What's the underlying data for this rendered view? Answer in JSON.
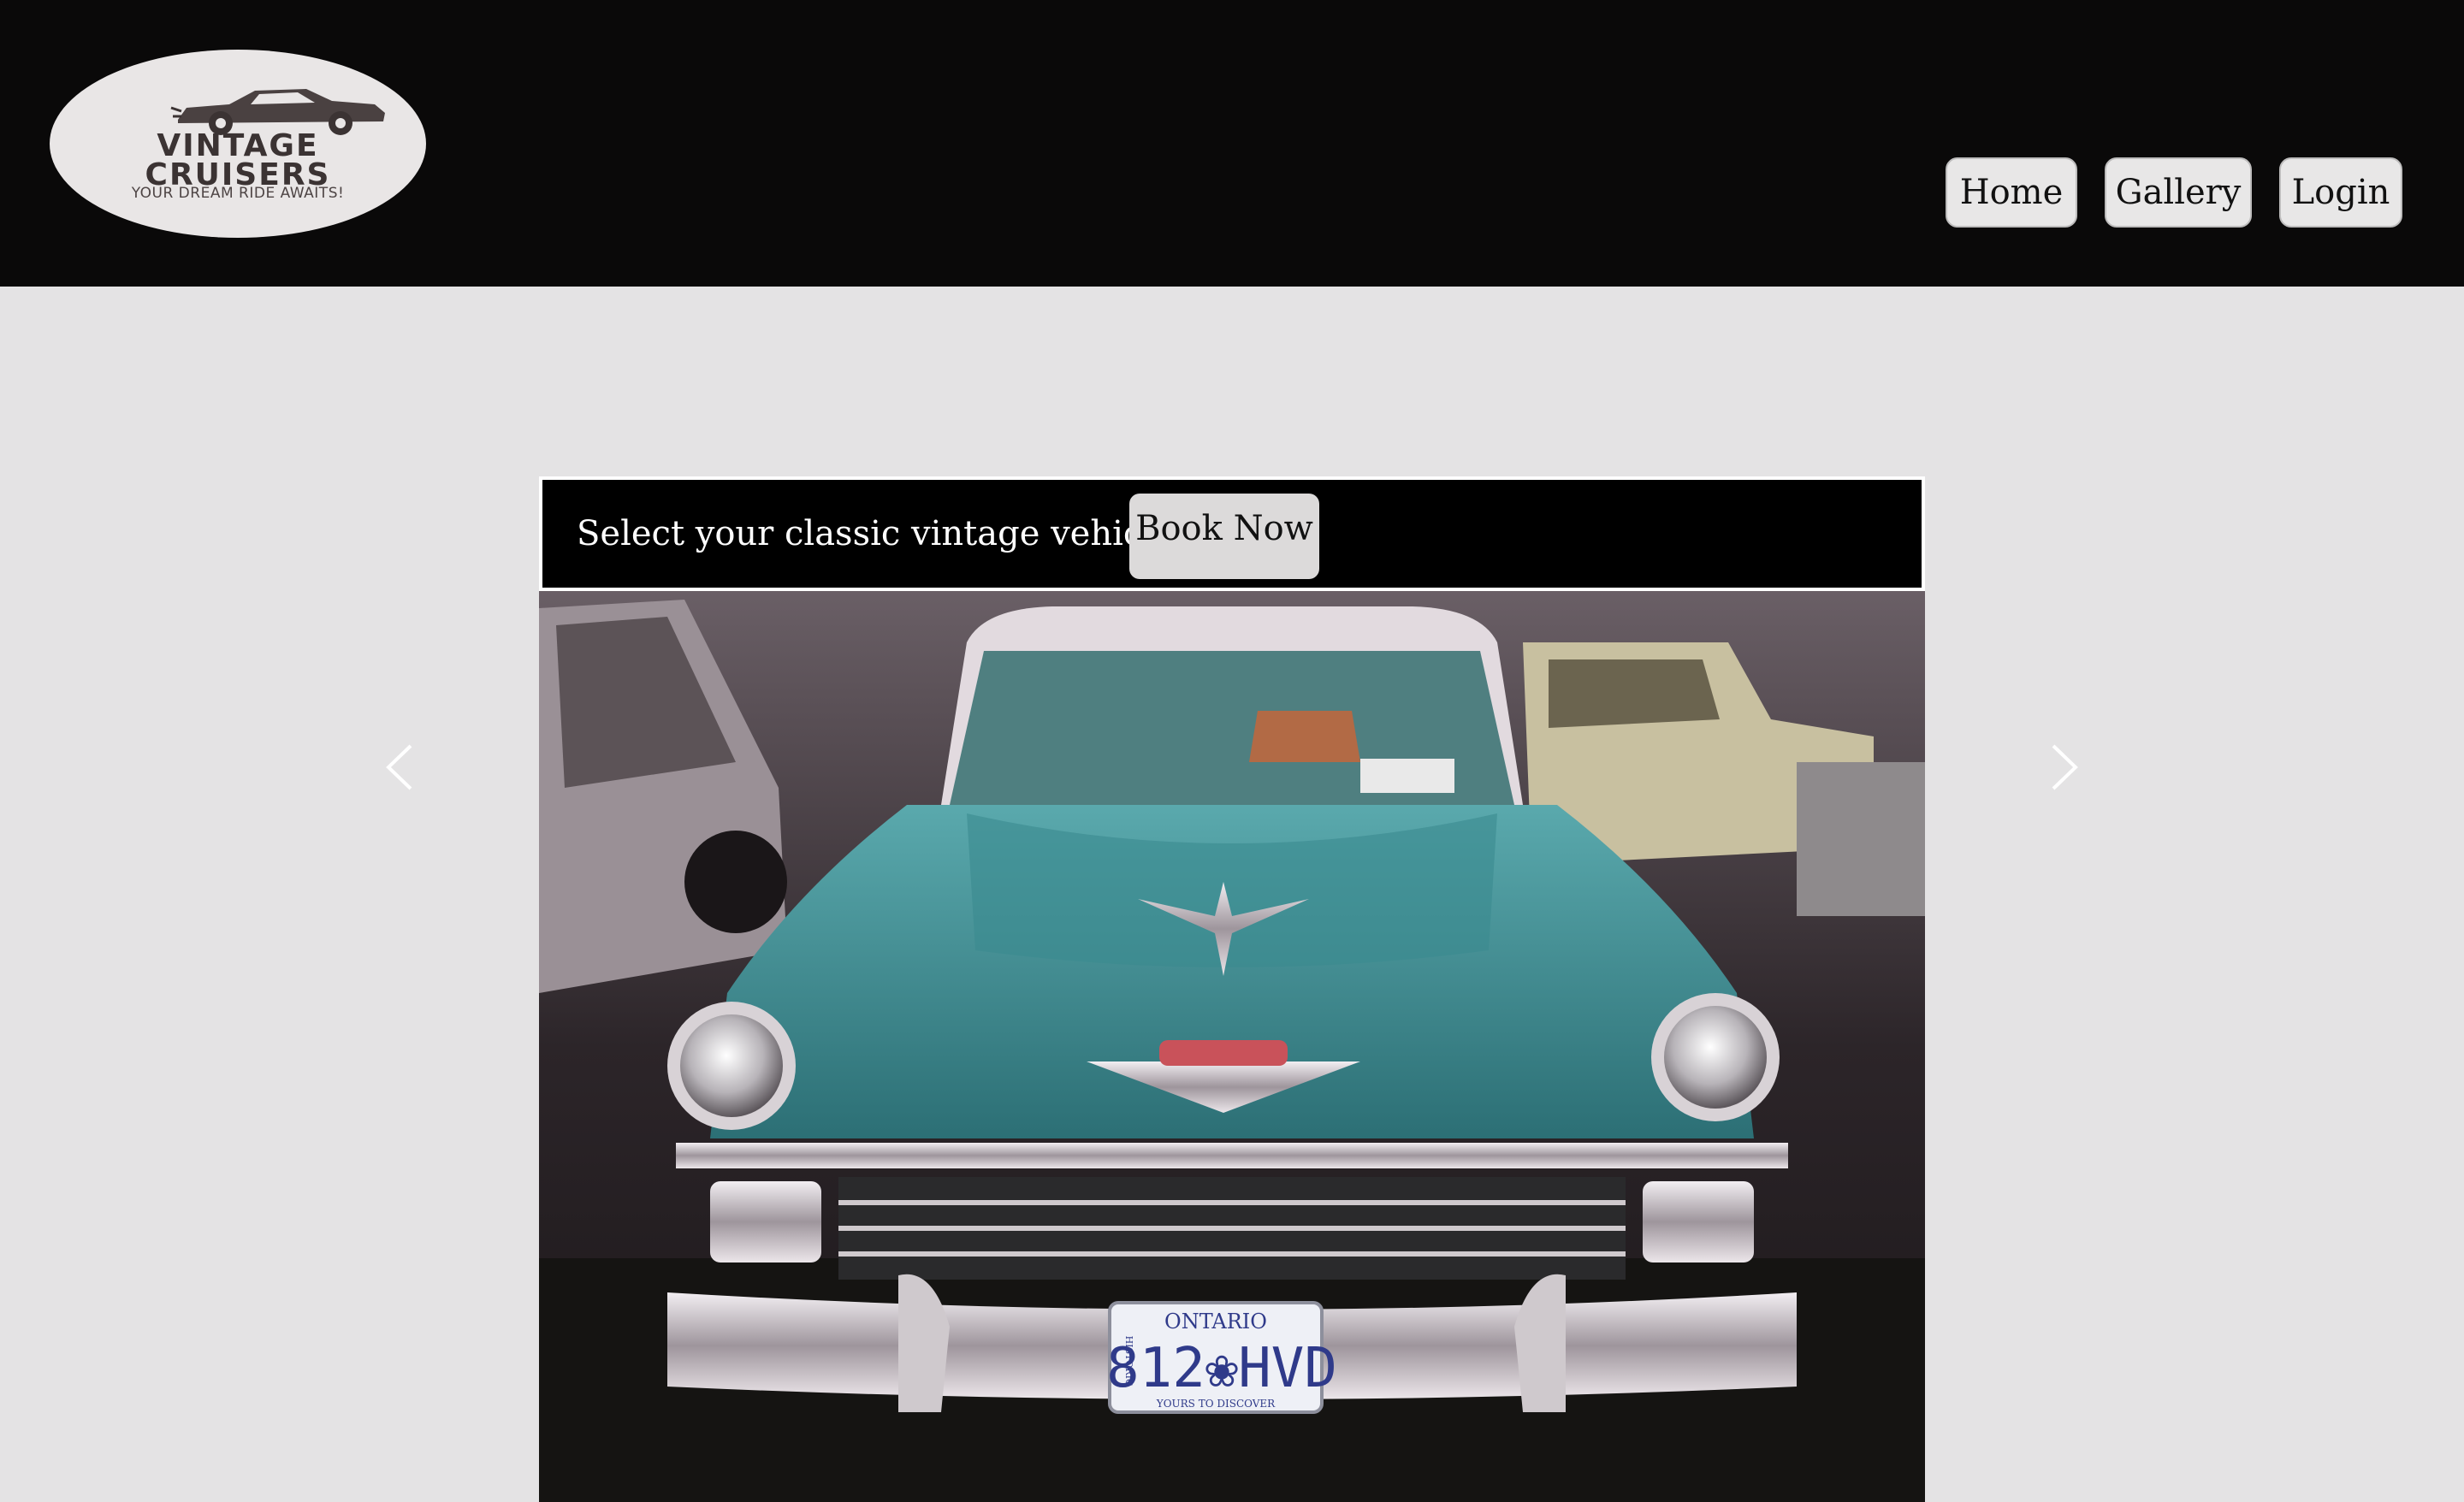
{
  "header": {
    "logo": {
      "line1": "VINTAGE",
      "line2": "CRUISERS",
      "tagline": "YOUR DREAM RIDE AWAITS!"
    },
    "nav": [
      {
        "label": "Home"
      },
      {
        "label": "Gallery"
      },
      {
        "label": "Login"
      }
    ]
  },
  "carousel": {
    "caption": "Select your classic vintage vehicle",
    "book_button": "Book Now",
    "slide": {
      "plate_region": "ONTARIO",
      "plate_number": "812❀HVD",
      "plate_side": "HISTORIC",
      "plate_slogan": "YOURS TO DISCOVER"
    },
    "prev_icon": "chevron-left-icon",
    "next_icon": "chevron-right-icon"
  },
  "colors": {
    "header_bg": "#0a0909",
    "page_bg": "#e4e3e4",
    "car_teal": "#3f8e93",
    "button_bg": "#e8e7e7"
  }
}
